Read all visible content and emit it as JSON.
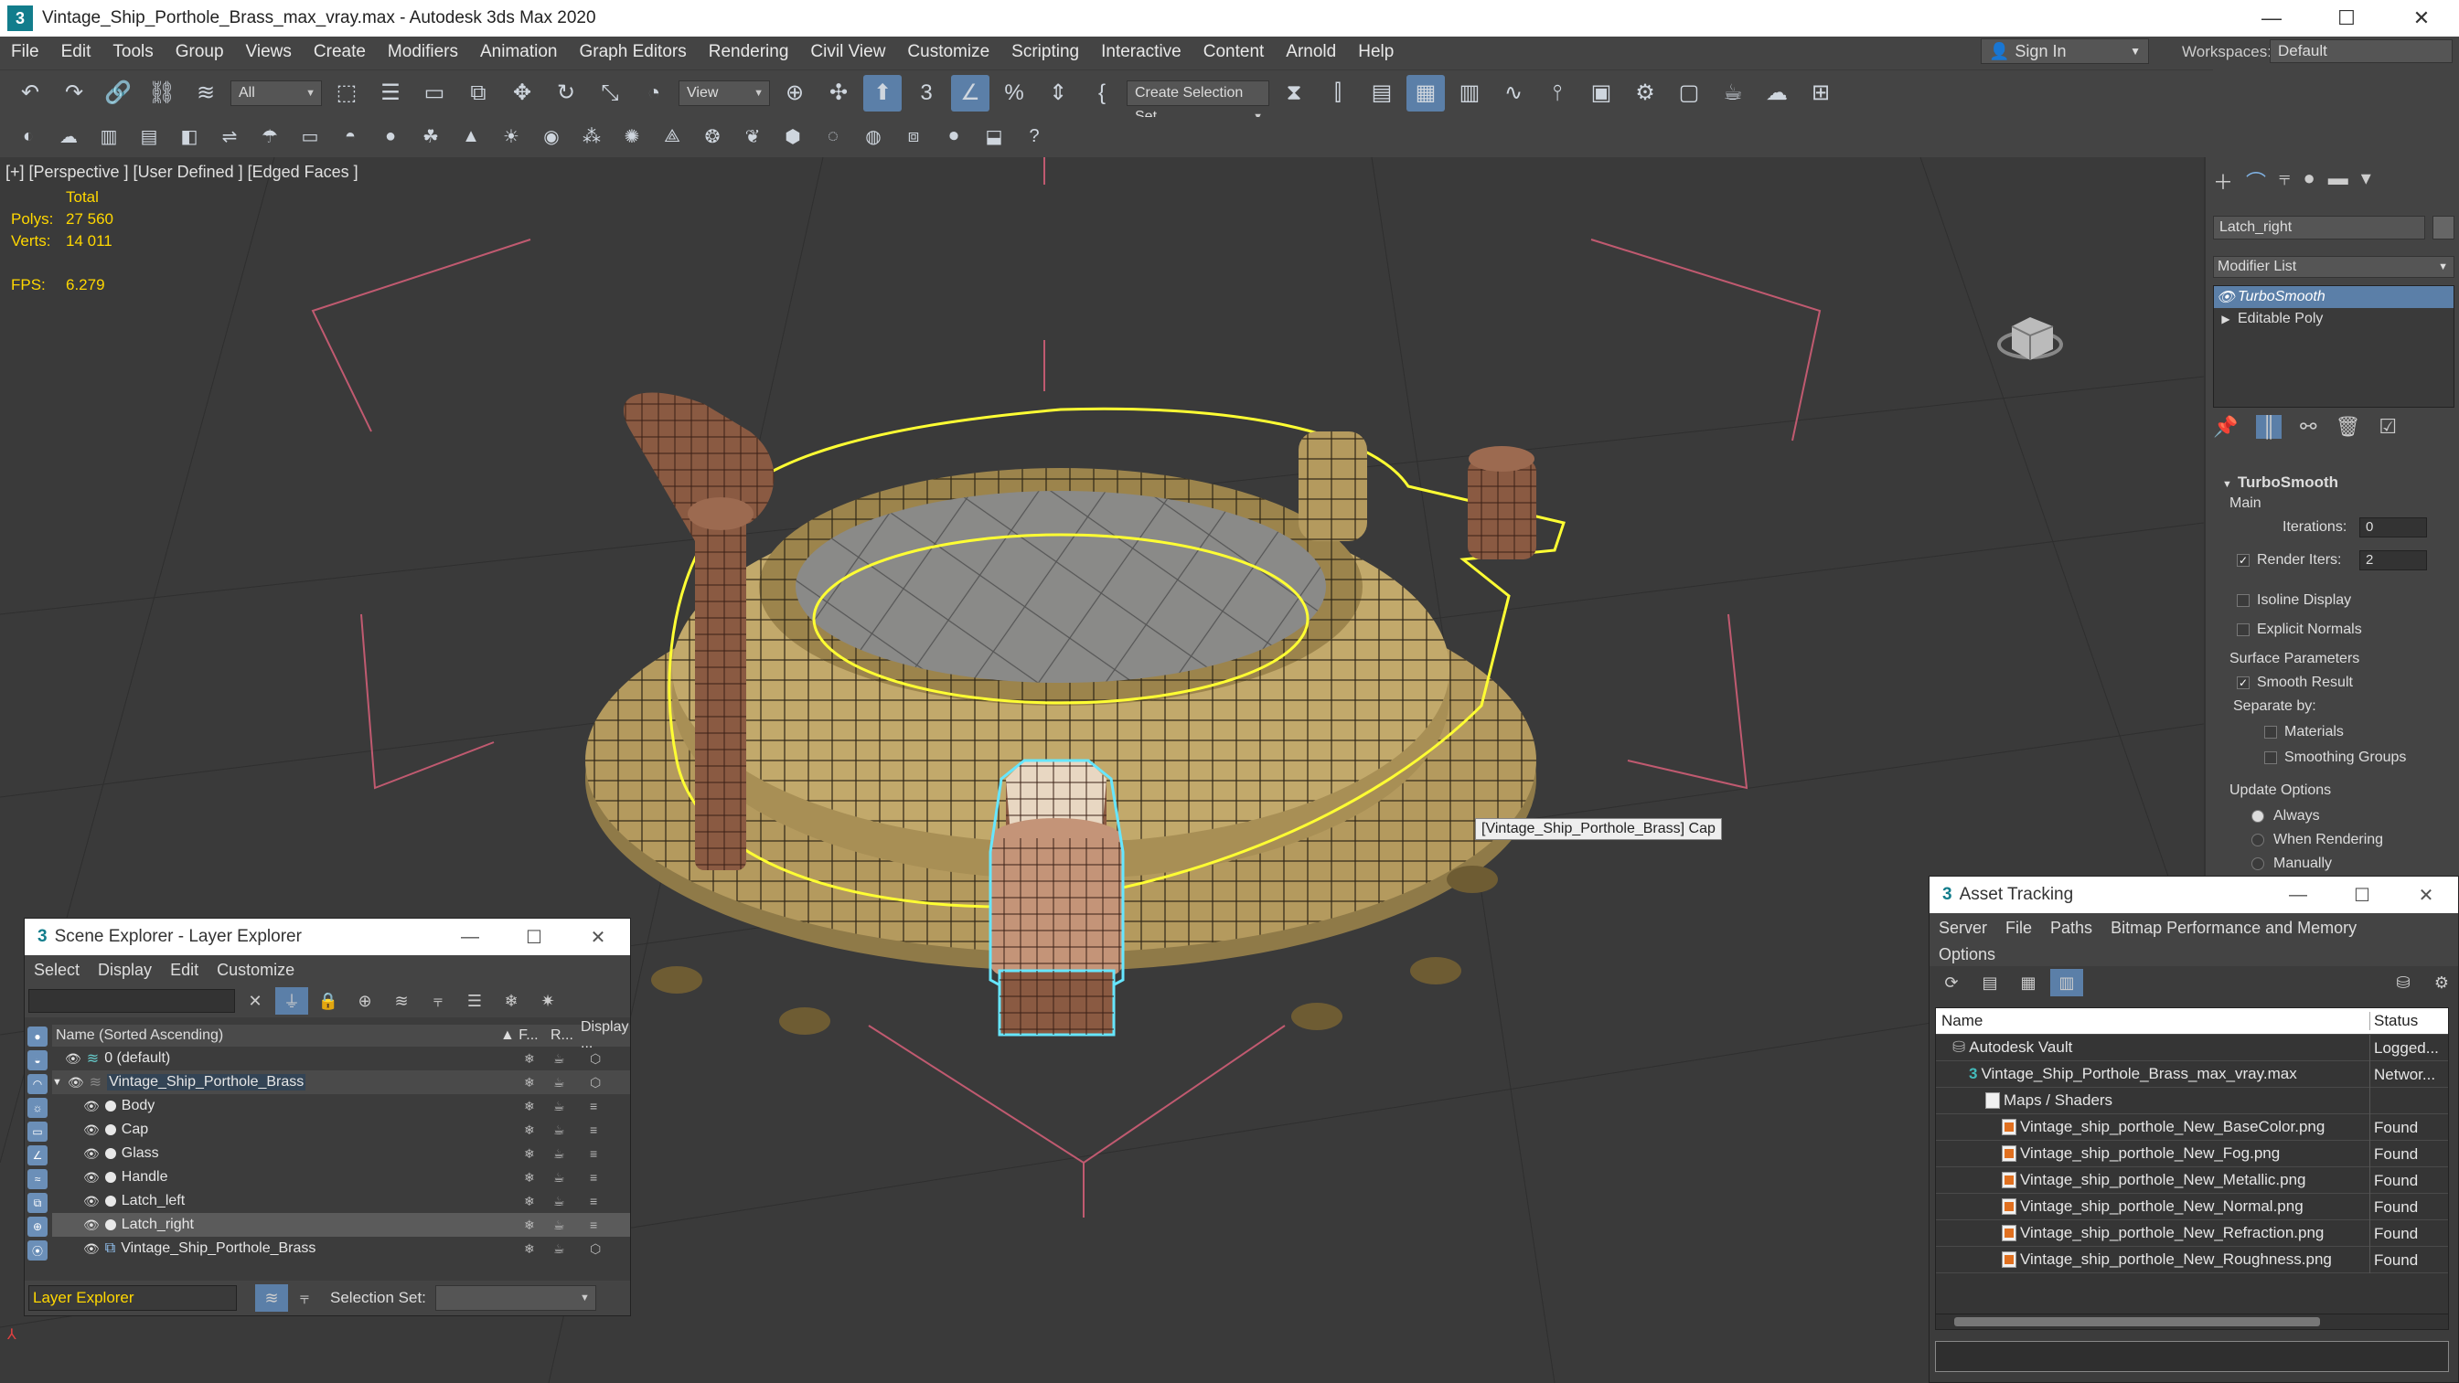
{
  "window": {
    "title": "Vintage_Ship_Porthole_Brass_max_vray.max - Autodesk 3ds Max 2020",
    "logo": "3",
    "minimize": "—",
    "maximize": "☐",
    "close": "✕"
  },
  "menu": {
    "items": [
      "File",
      "Edit",
      "Tools",
      "Group",
      "Views",
      "Create",
      "Modifiers",
      "Animation",
      "Graph Editors",
      "Rendering",
      "Civil View",
      "Customize",
      "Scripting",
      "Interactive",
      "Content",
      "Arnold",
      "Help"
    ],
    "sign_in": "Sign In",
    "workspaces_label": "Workspaces:",
    "workspace_value": "Default"
  },
  "toolbar": {
    "selection_filter": "All",
    "ref_coord": "View",
    "named_selection": "Create Selection Set"
  },
  "viewport": {
    "label": "[+] [Perspective ] [User Defined ] [Edged Faces ]",
    "stats_total": "Total",
    "polys_label": "Polys:",
    "polys_value": "27 560",
    "verts_label": "Verts:",
    "verts_value": "14 011",
    "fps_label": "FPS:",
    "fps_value": "6.279",
    "tooltip": "[Vintage_Ship_Porthole_Brass] Cap"
  },
  "command_panel": {
    "object_name": "Latch_right",
    "modifier_list_label": "Modifier List",
    "stack": [
      "TurboSmooth",
      "Editable Poly"
    ],
    "rollout_title": "TurboSmooth",
    "main_label": "Main",
    "iterations_label": "Iterations:",
    "iterations_value": "0",
    "render_iters_label": "Render Iters:",
    "render_iters_value": "2",
    "isoline_display": "Isoline Display",
    "explicit_normals": "Explicit Normals",
    "surface_params": "Surface Parameters",
    "smooth_result": "Smooth Result",
    "separate_by": "Separate by:",
    "materials": "Materials",
    "smoothing_groups": "Smoothing Groups",
    "update_options": "Update Options",
    "always": "Always",
    "when_rendering": "When Rendering",
    "manually": "Manually"
  },
  "scene_explorer": {
    "title": "Scene Explorer - Layer Explorer",
    "menu": [
      "Select",
      "Display",
      "Edit",
      "Customize"
    ],
    "col_name": "Name (Sorted Ascending)",
    "col_f": "▲ F...",
    "col_r": "R...",
    "col_display": "Display ...",
    "rows": [
      {
        "name": "0 (default)"
      },
      {
        "name": "Vintage_Ship_Porthole_Brass"
      },
      {
        "name": "Body"
      },
      {
        "name": "Cap"
      },
      {
        "name": "Glass"
      },
      {
        "name": "Handle"
      },
      {
        "name": "Latch_left"
      },
      {
        "name": "Latch_right"
      },
      {
        "name": "Vintage_Ship_Porthole_Brass"
      }
    ],
    "footer_label": "Layer Explorer",
    "selection_set_label": "Selection Set:"
  },
  "asset_tracking": {
    "title": "Asset Tracking",
    "menu": [
      "Server",
      "File",
      "Paths",
      "Bitmap Performance and Memory"
    ],
    "menu2": "Options",
    "col_name": "Name",
    "col_status": "Status",
    "rows": [
      {
        "name": "Autodesk Vault",
        "status": "Logged..."
      },
      {
        "name": "Vintage_Ship_Porthole_Brass_max_vray.max",
        "status": "Networ..."
      },
      {
        "name": "Maps / Shaders",
        "status": ""
      },
      {
        "name": "Vintage_ship_porthole_New_BaseColor.png",
        "status": "Found"
      },
      {
        "name": "Vintage_ship_porthole_New_Fog.png",
        "status": "Found"
      },
      {
        "name": "Vintage_ship_porthole_New_Metallic.png",
        "status": "Found"
      },
      {
        "name": "Vintage_ship_porthole_New_Normal.png",
        "status": "Found"
      },
      {
        "name": "Vintage_ship_porthole_New_Refraction.png",
        "status": "Found"
      },
      {
        "name": "Vintage_ship_porthole_New_Roughness.png",
        "status": "Found"
      }
    ]
  },
  "colors": {
    "accent": "#5b7fa8",
    "selection_outline": "#ffff33",
    "cap_selection": "#66e6ff",
    "stats": "#ffd700",
    "brass": "#b49a5e",
    "copper": "#8a5a42"
  }
}
